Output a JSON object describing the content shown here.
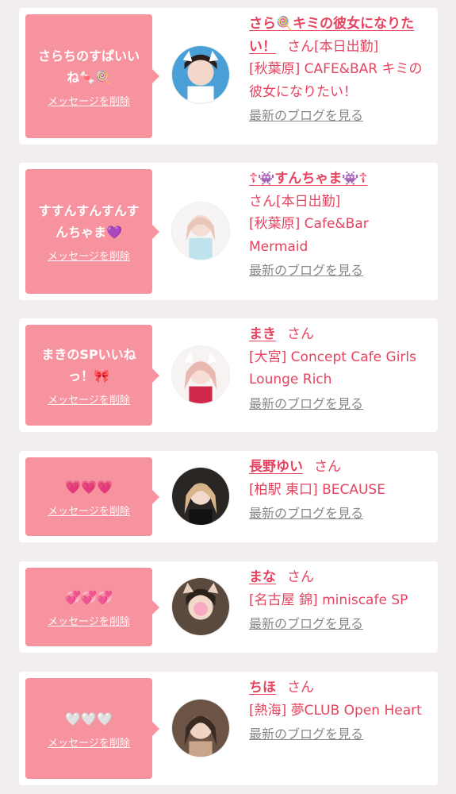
{
  "items": [
    {
      "message": "さらちのすぱいいね🍬🍭",
      "delete_label": "メッセージを削除",
      "name": "さら🍭キミの彼女になりたい！",
      "honorific": "さん",
      "status": "[本日出勤]",
      "shop": "[秋葉原] CAFE&BAR キミの彼女になりたい！",
      "blog_label": "最新のブログを見る"
    },
    {
      "message": "すすんすんすんすんちゃま💜",
      "delete_label": "メッセージを削除",
      "name": "☦👾すんちゃま👾☦",
      "honorific": "さん",
      "status": "[本日出勤]",
      "shop": "[秋葉原] Cafe&Bar Mermaid",
      "blog_label": "最新のブログを見る"
    },
    {
      "message": "まきのSPいいねっ！🎀",
      "delete_label": "メッセージを削除",
      "name": "まき",
      "honorific": "さん",
      "status": "",
      "shop": "[大宮] Concept Cafe Girls Lounge Rich",
      "blog_label": "最新のブログを見る"
    },
    {
      "message": "💗💗💗",
      "delete_label": "メッセージを削除",
      "name": "長野ゆい",
      "honorific": "さん",
      "status": "",
      "shop": "[柏駅 東口] BECAUSE",
      "blog_label": "最新のブログを見る"
    },
    {
      "message": "💞💞💞",
      "delete_label": "メッセージを削除",
      "name": "まな",
      "honorific": "さん",
      "status": "",
      "shop": "[名古屋 錦] miniscafe SP",
      "blog_label": "最新のブログを見る"
    },
    {
      "message": "🤍🤍🤍",
      "delete_label": "メッセージを削除",
      "name": "ちほ",
      "honorific": "さん",
      "status": "",
      "shop": "[熱海] 夢CLUB Open Heart",
      "blog_label": "最新のブログを見る"
    }
  ],
  "colors": {
    "accent": "#e6435f",
    "bubble": "#f7929f",
    "link_gray": "#888888",
    "background": "#f2eeef"
  }
}
